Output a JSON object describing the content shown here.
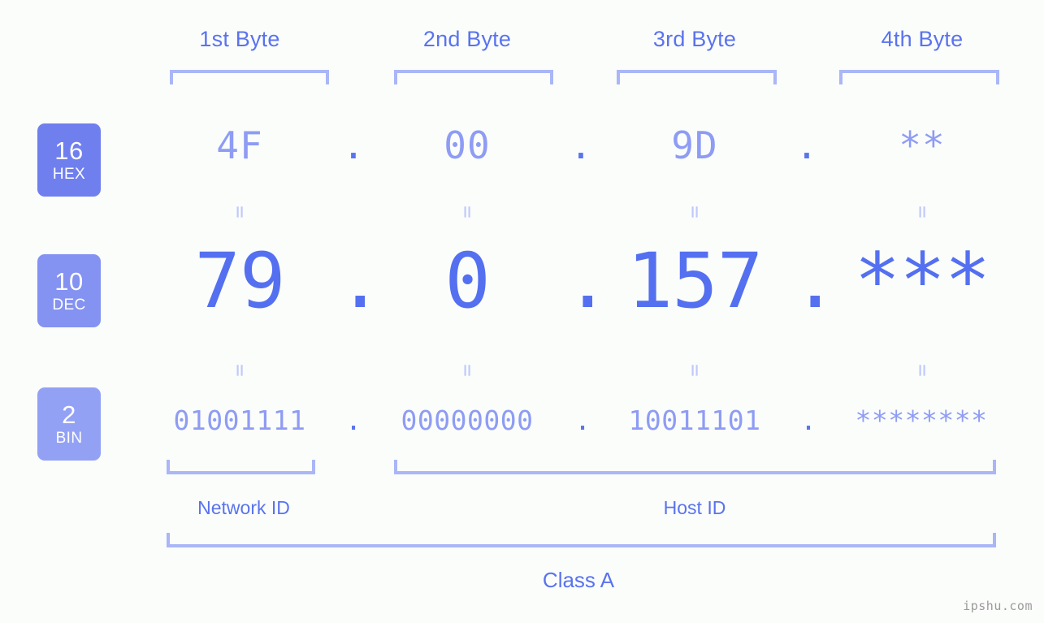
{
  "ip": {
    "bytes": [
      {
        "header": "1st Byte",
        "hex": "4F",
        "dec": "79",
        "bin": "01001111"
      },
      {
        "header": "2nd Byte",
        "hex": "00",
        "dec": "0",
        "bin": "00000000"
      },
      {
        "header": "3rd Byte",
        "hex": "9D",
        "dec": "157",
        "bin": "10011101"
      },
      {
        "header": "4th Byte",
        "hex": "**",
        "dec": "***",
        "bin": "********"
      }
    ],
    "separator": ".",
    "equals_glyph": "="
  },
  "bases": [
    {
      "number": "16",
      "abbr": "HEX"
    },
    {
      "number": "10",
      "abbr": "DEC"
    },
    {
      "number": "2",
      "abbr": "BIN"
    }
  ],
  "sections": {
    "network_id": "Network ID",
    "host_id": "Host ID",
    "class": "Class A"
  },
  "watermark": "ipshu.com",
  "colors": {
    "background": "#fbfdfb",
    "primary": "#5470f0",
    "muted": "#8e9cf4",
    "bracket": "#aab6f7",
    "badge_hex": "#707fee",
    "badge_dec": "#8492f2",
    "badge_bin": "#93a1f5",
    "equals": "#c0c9fa",
    "watermark": "#9a9a9a"
  }
}
